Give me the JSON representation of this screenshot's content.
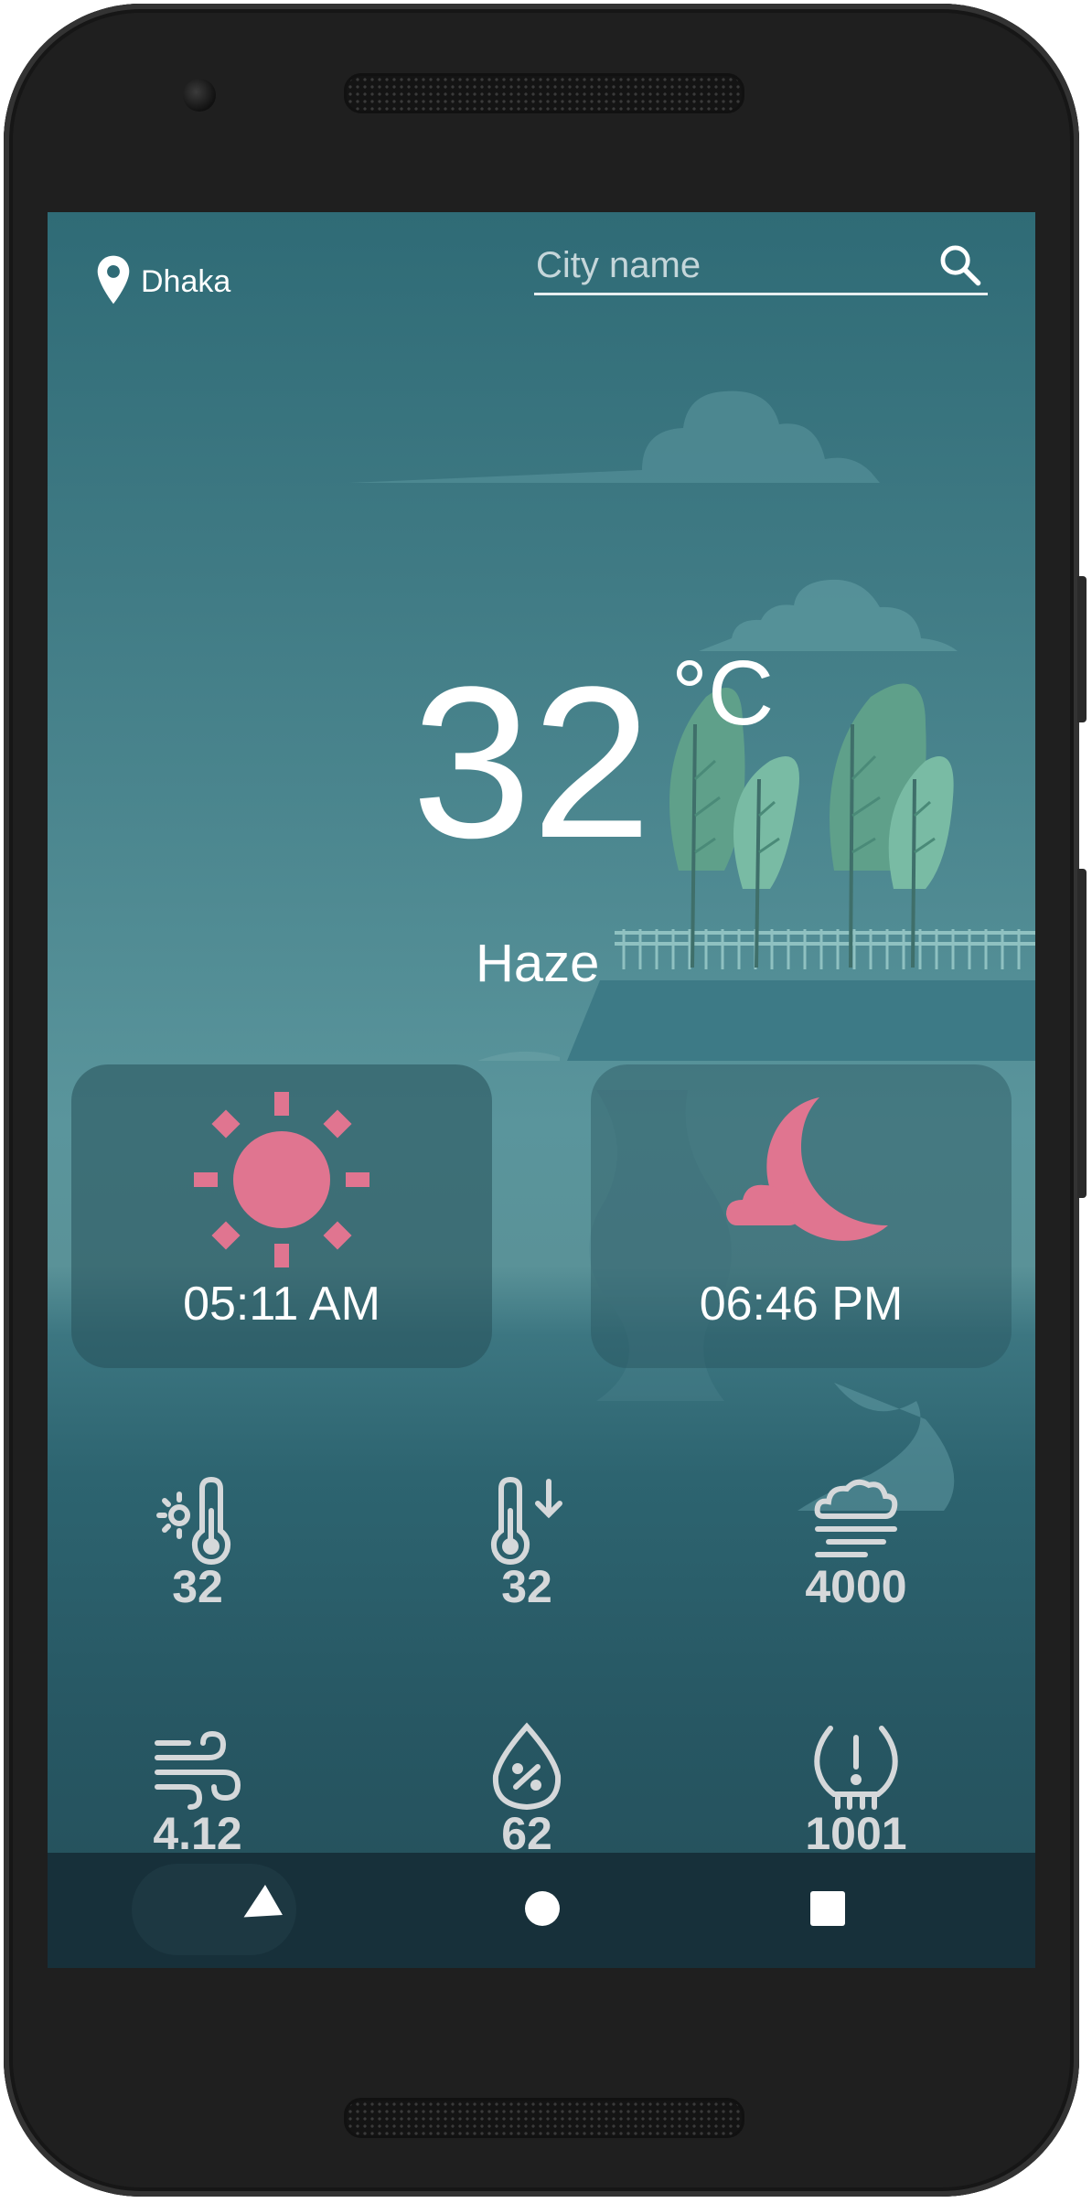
{
  "location": {
    "city": "Dhaka"
  },
  "search": {
    "placeholder": "City name"
  },
  "current": {
    "temperature": "32",
    "unit": "°C",
    "condition": "Haze"
  },
  "sun": {
    "sunrise": "05:11 AM",
    "sunset": "06:46 PM"
  },
  "stats": [
    {
      "icon": "feels-like-thermometer-icon",
      "value": "32"
    },
    {
      "icon": "min-temperature-icon",
      "value": "32"
    },
    {
      "icon": "visibility-fog-icon",
      "value": "4000"
    },
    {
      "icon": "wind-icon",
      "value": "4.12"
    },
    {
      "icon": "humidity-icon",
      "value": "62"
    },
    {
      "icon": "pressure-icon",
      "value": "1001"
    }
  ],
  "colors": {
    "accent": "#e07590",
    "text": "#ffffff",
    "stat_text": "#d5d8da",
    "tree": "#6aa892"
  }
}
